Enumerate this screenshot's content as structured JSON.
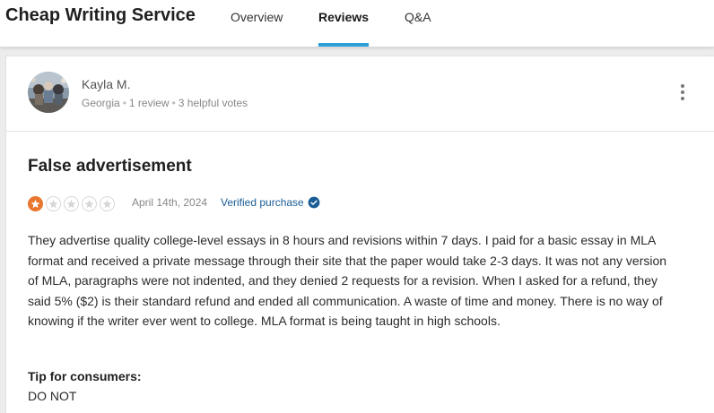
{
  "header": {
    "brand": "Cheap Writing Service",
    "tabs": [
      {
        "label": "Overview",
        "active": false
      },
      {
        "label": "Reviews",
        "active": true
      },
      {
        "label": "Q&A",
        "active": false
      }
    ]
  },
  "reviewer": {
    "name": "Kayla M.",
    "location": "Georgia",
    "reviews": "1 review",
    "helpful_votes": "3 helpful votes",
    "menu_icon": "more-vertical-icon"
  },
  "review": {
    "title": "False advertisement",
    "rating": 1,
    "max_rating": 5,
    "date": "April 14th, 2024",
    "verified_label": "Verified purchase",
    "body": "They advertise quality college-level essays in 8 hours and revisions within 7 days. I paid for a basic essay in MLA format and received a private message through their site that the paper would take 2-3 days. It was not any version of MLA, paragraphs were not indented, and they denied 2 requests for a revision. When I asked for a refund, they said 5% ($2) is their standard refund and ended all communication. A waste of time and money. There is no way of knowing if the writer ever went to college. MLA format is being taught in high schools.",
    "tip_label": "Tip for consumers:",
    "tip_text": "DO NOT"
  },
  "colors": {
    "accent": "#2a9fd8",
    "star_filled": "#e8762c",
    "verified": "#1a5c95"
  }
}
